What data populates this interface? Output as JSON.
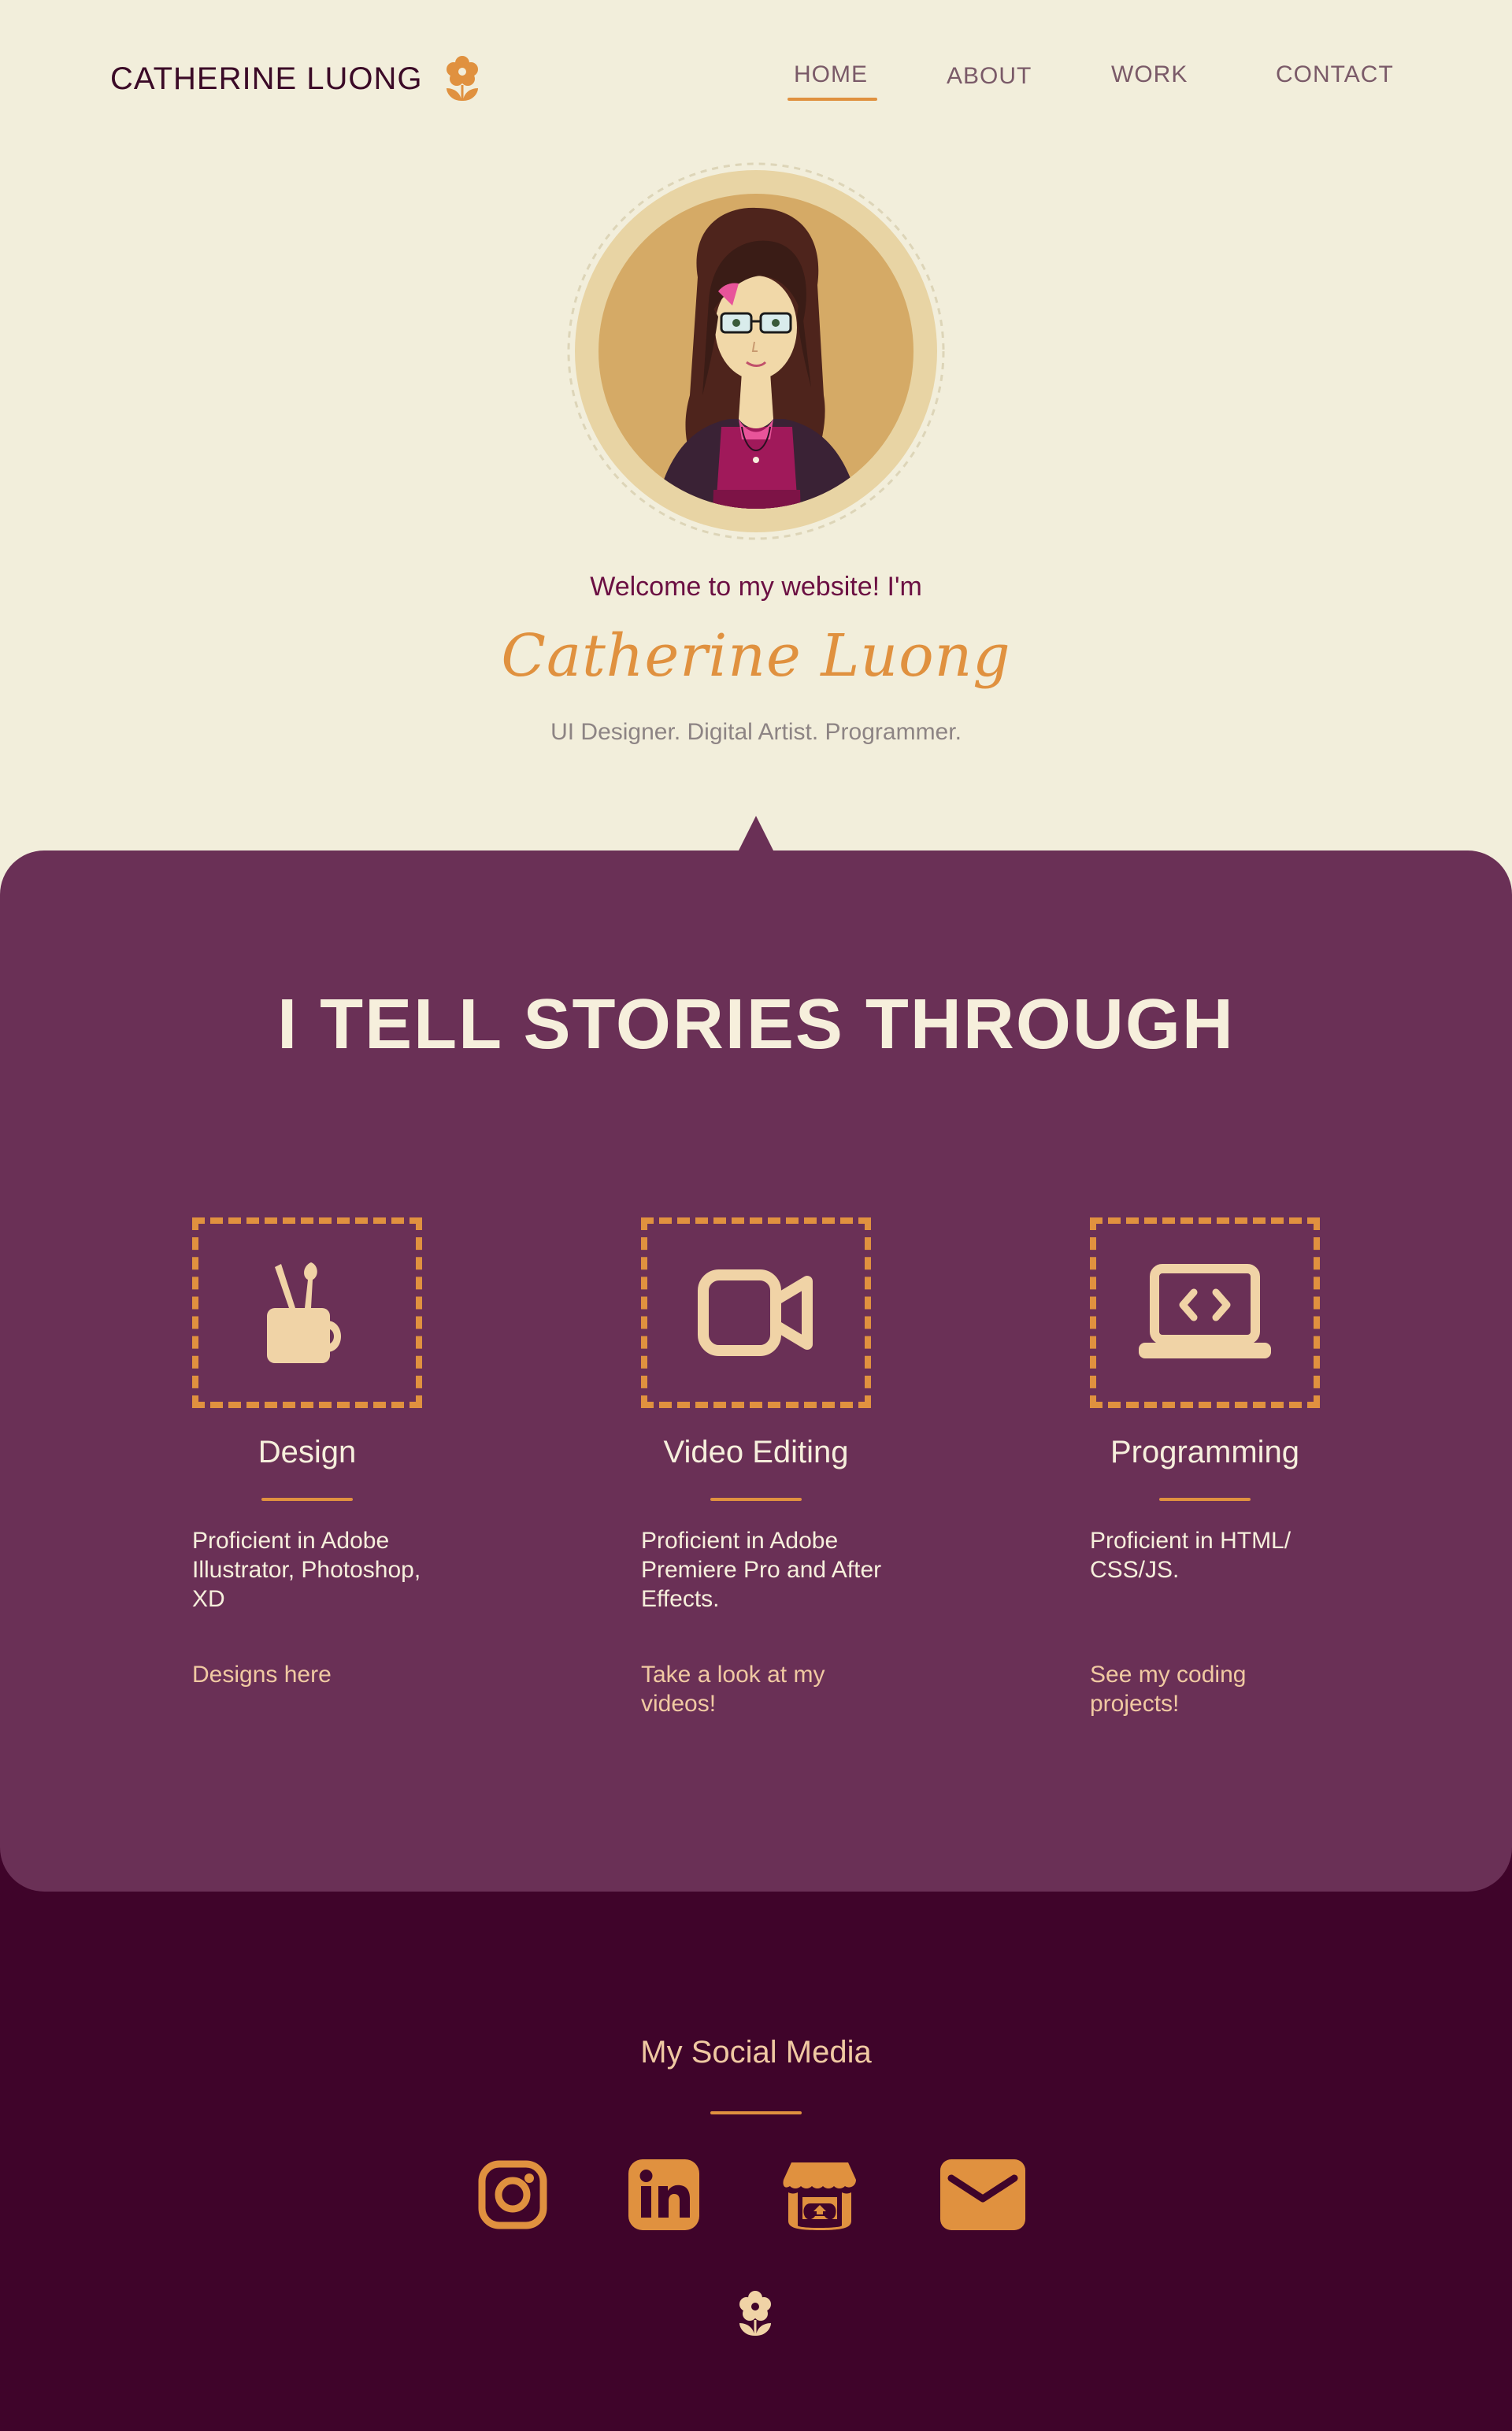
{
  "header": {
    "brand_name": "CATHERINE LUONG",
    "brand_icon": "flower-icon",
    "nav": [
      {
        "label": "HOME",
        "active": true
      },
      {
        "label": "ABOUT",
        "active": false
      },
      {
        "label": "WORK",
        "active": false
      },
      {
        "label": "CONTACT",
        "active": false
      }
    ]
  },
  "hero": {
    "welcome": "Welcome to my website! I'm",
    "name": "Catherine Luong",
    "tagline": "UI Designer. Digital Artist. Programmer.",
    "avatar_icon": "portrait-illustration"
  },
  "stories": {
    "title": "I TELL STORIES THROUGH",
    "skills": [
      {
        "icon": "mug-brushes-icon",
        "title": "Design",
        "description": "Proficient in Adobe Illustrator, Photoshop, XD",
        "link": "Designs here"
      },
      {
        "icon": "video-camera-icon",
        "title": "Video Editing",
        "description": "Proficient in Adobe Premiere Pro and After Effects.",
        "link": "Take a look at my videos!"
      },
      {
        "icon": "laptop-code-icon",
        "title": "Programming",
        "description": "Proficient in HTML/ CSS/JS.",
        "link": "See my coding projects!"
      }
    ]
  },
  "footer": {
    "social_title": "My Social Media",
    "social_icons": [
      "instagram-icon",
      "linkedin-icon",
      "itch-io-icon",
      "email-icon"
    ],
    "footer_icon": "flower-icon"
  },
  "colors": {
    "background": "#f2eedb",
    "accent": "#e0913f",
    "purple": "#6a3056",
    "dark_purple": "#3f042a",
    "cream": "#f6efdc",
    "brand_text": "#3b0a27"
  }
}
